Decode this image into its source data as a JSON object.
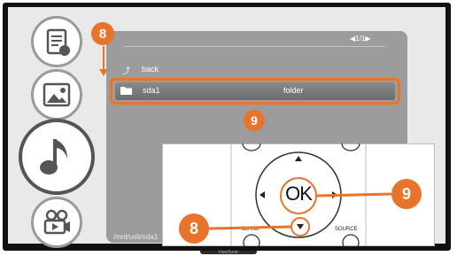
{
  "browser": {
    "page_indicator": "◀1/1▶",
    "back_label": "back",
    "selected_row": {
      "name": "sda1",
      "type": "folder"
    },
    "path": "/mnt/usb/sda1"
  },
  "remote": {
    "ok_label": "OK",
    "blank_label": "BLANK",
    "source_label": "SOURCE"
  },
  "callouts": {
    "step_8": "8",
    "step_9": "9"
  },
  "tv": {
    "brand": "ViewSonic"
  },
  "colors": {
    "accent": "#e7742a",
    "panel": "#9c9c9c",
    "bezel": "#111111"
  },
  "icons": [
    "document-icon",
    "image-icon",
    "music-icon",
    "video-icon",
    "folder-icon",
    "back-arrow-icon"
  ]
}
